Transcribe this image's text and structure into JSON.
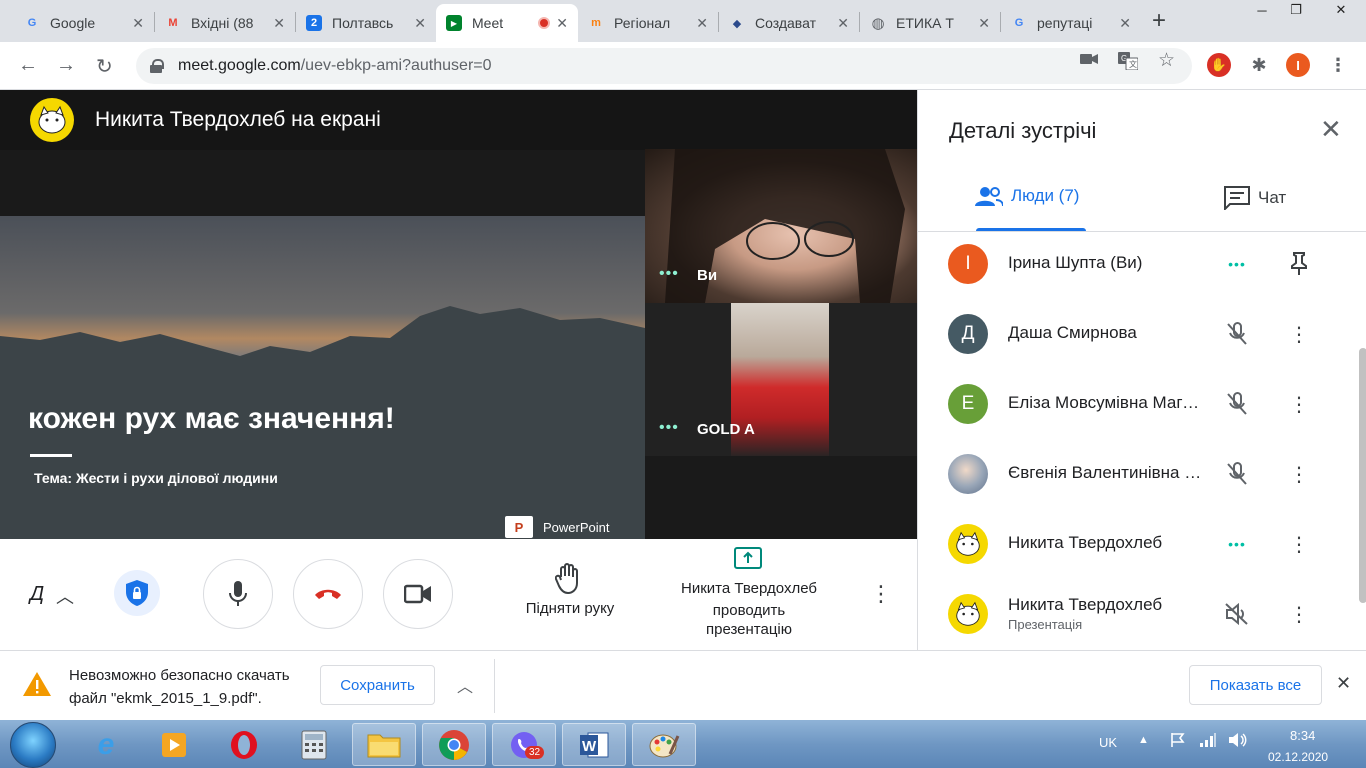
{
  "tabs": [
    {
      "title": "Google",
      "favicon": "google-icon",
      "color": "#4285f4",
      "glyph": "G"
    },
    {
      "title": "Вхідні (88",
      "favicon": "gmail-icon",
      "color": "#ea4335",
      "glyph": "M"
    },
    {
      "title": "Полтавсь",
      "favicon": "calendar-icon",
      "color": "#1a73e8",
      "glyph": "2"
    },
    {
      "title": "Meet",
      "favicon": "meet-icon",
      "color": "#00832d",
      "glyph": "▶"
    },
    {
      "title": "Регіонал",
      "favicon": "moodle-icon",
      "color": "#f98012",
      "glyph": "m"
    },
    {
      "title": "Создават",
      "favicon": "crest-icon",
      "color": "#2b4a8c",
      "glyph": "◆"
    },
    {
      "title": "ЕТИКА Т",
      "favicon": "globe-icon",
      "color": "#5f6368",
      "glyph": "◍"
    },
    {
      "title": "репутаці",
      "favicon": "google-icon",
      "color": "#4285f4",
      "glyph": "G"
    }
  ],
  "address": {
    "host": "meet.google.com",
    "path": "/uev-ebkp-ami?authuser=0"
  },
  "profile_initial": "I",
  "presenter": {
    "name_banner": "Никита Твердохлеб на екрані"
  },
  "slide": {
    "title": "кожен рух має значення!",
    "subtitle": "Тема: Жести і рухи ділової людини",
    "badge": "PowerPoint",
    "badge_glyph": "P"
  },
  "tiles": [
    {
      "name": "Ви",
      "dots": "•••"
    },
    {
      "name": "GOLD A",
      "dots": "•••"
    }
  ],
  "controls": {
    "truncated_name": "Д",
    "raise_hand": "Підняти руку",
    "presenting_name": "Никита Твердохлеб",
    "presenting_line1": "проводить",
    "presenting_line2": "презентацію"
  },
  "panel": {
    "title": "Деталі зустрічі",
    "tab_people": "Люди (7)",
    "tab_chat": "Чат",
    "people": [
      {
        "name": "Ірина Шупта (Ви)",
        "initial": "І",
        "color": "#ea5a1f",
        "status": "speaking",
        "action": "pin",
        "sub": ""
      },
      {
        "name": "Даша Смирнова",
        "initial": "Д",
        "color": "#455a64",
        "status": "muted",
        "action": "menu",
        "sub": ""
      },
      {
        "name": "Еліза Мовсумівна Магеррамова",
        "initial": "Е",
        "color": "#689f38",
        "status": "muted",
        "action": "menu",
        "sub": ""
      },
      {
        "name": "Євгенія Валентинівна Гончаренко",
        "initial": "",
        "color": "#b0bec5",
        "status": "muted",
        "action": "menu",
        "sub": ""
      },
      {
        "name": "Никита Твердохлеб",
        "initial": "",
        "color": "#f5d800",
        "status": "speaking",
        "action": "menu",
        "sub": ""
      },
      {
        "name": "Никита Твердохлеб",
        "initial": "",
        "color": "#f5d800",
        "status": "muted-speaker",
        "action": "menu",
        "sub": "Презентація"
      }
    ]
  },
  "download": {
    "line1": "Невозможно безопасно скачать",
    "line2": "файл \"ekmk_2015_1_9.pdf\".",
    "save": "Сохранить",
    "show_all": "Показать все"
  },
  "taskbar": {
    "lang": "UK",
    "time": "8:34",
    "date": "02.12.2020",
    "viber_badge": "32"
  },
  "colors": {
    "accent": "#1a73e8",
    "speaking": "#00bfa5",
    "end_call": "#d93025"
  }
}
